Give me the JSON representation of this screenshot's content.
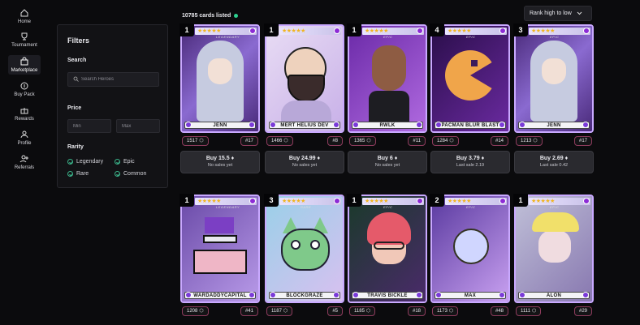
{
  "nav": [
    {
      "label": "Home",
      "icon": "home-icon"
    },
    {
      "label": "Tournament",
      "icon": "trophy-icon"
    },
    {
      "label": "Marketplace",
      "icon": "bag-icon",
      "active": true
    },
    {
      "label": "Buy Pack",
      "icon": "coin-icon"
    },
    {
      "label": "Rewards",
      "icon": "gift-icon"
    },
    {
      "label": "Profile",
      "icon": "user-icon"
    },
    {
      "label": "Referrals",
      "icon": "user-plus-icon"
    }
  ],
  "filters": {
    "title": "Filters",
    "search_label": "Search",
    "search_placeholder": "Search Heroes",
    "price_label": "Price",
    "min_placeholder": "Min",
    "max_placeholder": "Max",
    "rarity_label": "Rarity",
    "rarities": [
      "Legendary",
      "Epic",
      "Rare",
      "Common"
    ]
  },
  "listed": "10785 cards listed",
  "sort": {
    "label": "Rank high to low"
  },
  "cards": [
    {
      "qty": "1",
      "name": "JENN",
      "rarity": "LEGENDARY",
      "stars": "★★★★★",
      "score": "1517",
      "rank": "#17",
      "price": "Buy 15.5",
      "sales": "No sales yet",
      "theme": "hood"
    },
    {
      "qty": "1",
      "name": "MERT HELIUS DEV",
      "rarity": "EPIC",
      "stars": "★★★★★",
      "score": "1466",
      "rank": "#8",
      "price": "Buy 24.99",
      "sales": "No sales yet",
      "theme": "bald"
    },
    {
      "qty": "1",
      "name": "RWLK",
      "rarity": "EPIC",
      "stars": "★★★★★",
      "score": "1365",
      "rank": "#11",
      "price": "Buy 6",
      "sales": "No sales yet",
      "theme": "rock"
    },
    {
      "qty": "4",
      "name": "PACMAN BLUR BLAST",
      "rarity": "EPIC",
      "stars": "★★★★★",
      "score": "1284",
      "rank": "#14",
      "price": "Buy 3.79",
      "sales": "Last sale 2.19",
      "theme": "pac"
    },
    {
      "qty": "3",
      "name": "JENN",
      "rarity": "EPIC",
      "stars": "★★★★★",
      "score": "1213",
      "rank": "#17",
      "price": "Buy 2.69",
      "sales": "Last sale 0.42",
      "theme": "hood"
    },
    {
      "qty": "1",
      "name": "WARDADDYCAPITAL",
      "rarity": "LEGENDARY",
      "stars": "★★★★★",
      "score": "1208",
      "rank": "#41",
      "theme": "pix"
    },
    {
      "qty": "3",
      "name": "BLOCKGRAZE",
      "rarity": "RARE",
      "stars": "★★★★★",
      "score": "1187",
      "rank": "#5",
      "theme": "cat"
    },
    {
      "qty": "1",
      "name": "TRAVIS BICKLE",
      "rarity": "EPIC",
      "stars": "★★★★★",
      "score": "1185",
      "rank": "#18",
      "theme": "red"
    },
    {
      "qty": "2",
      "name": "MAX",
      "rarity": "EPIC",
      "stars": "★★★★★",
      "score": "1173",
      "rank": "#48",
      "theme": "max"
    },
    {
      "qty": "1",
      "name": "ALON",
      "rarity": "EPIC",
      "stars": "★★★★★",
      "score": "1111",
      "rank": "#29",
      "theme": "doll"
    }
  ],
  "colors": {
    "accent_green": "#2cd08f",
    "badge_border": "#8d3b5c",
    "card_border": "#c9a9ff"
  }
}
